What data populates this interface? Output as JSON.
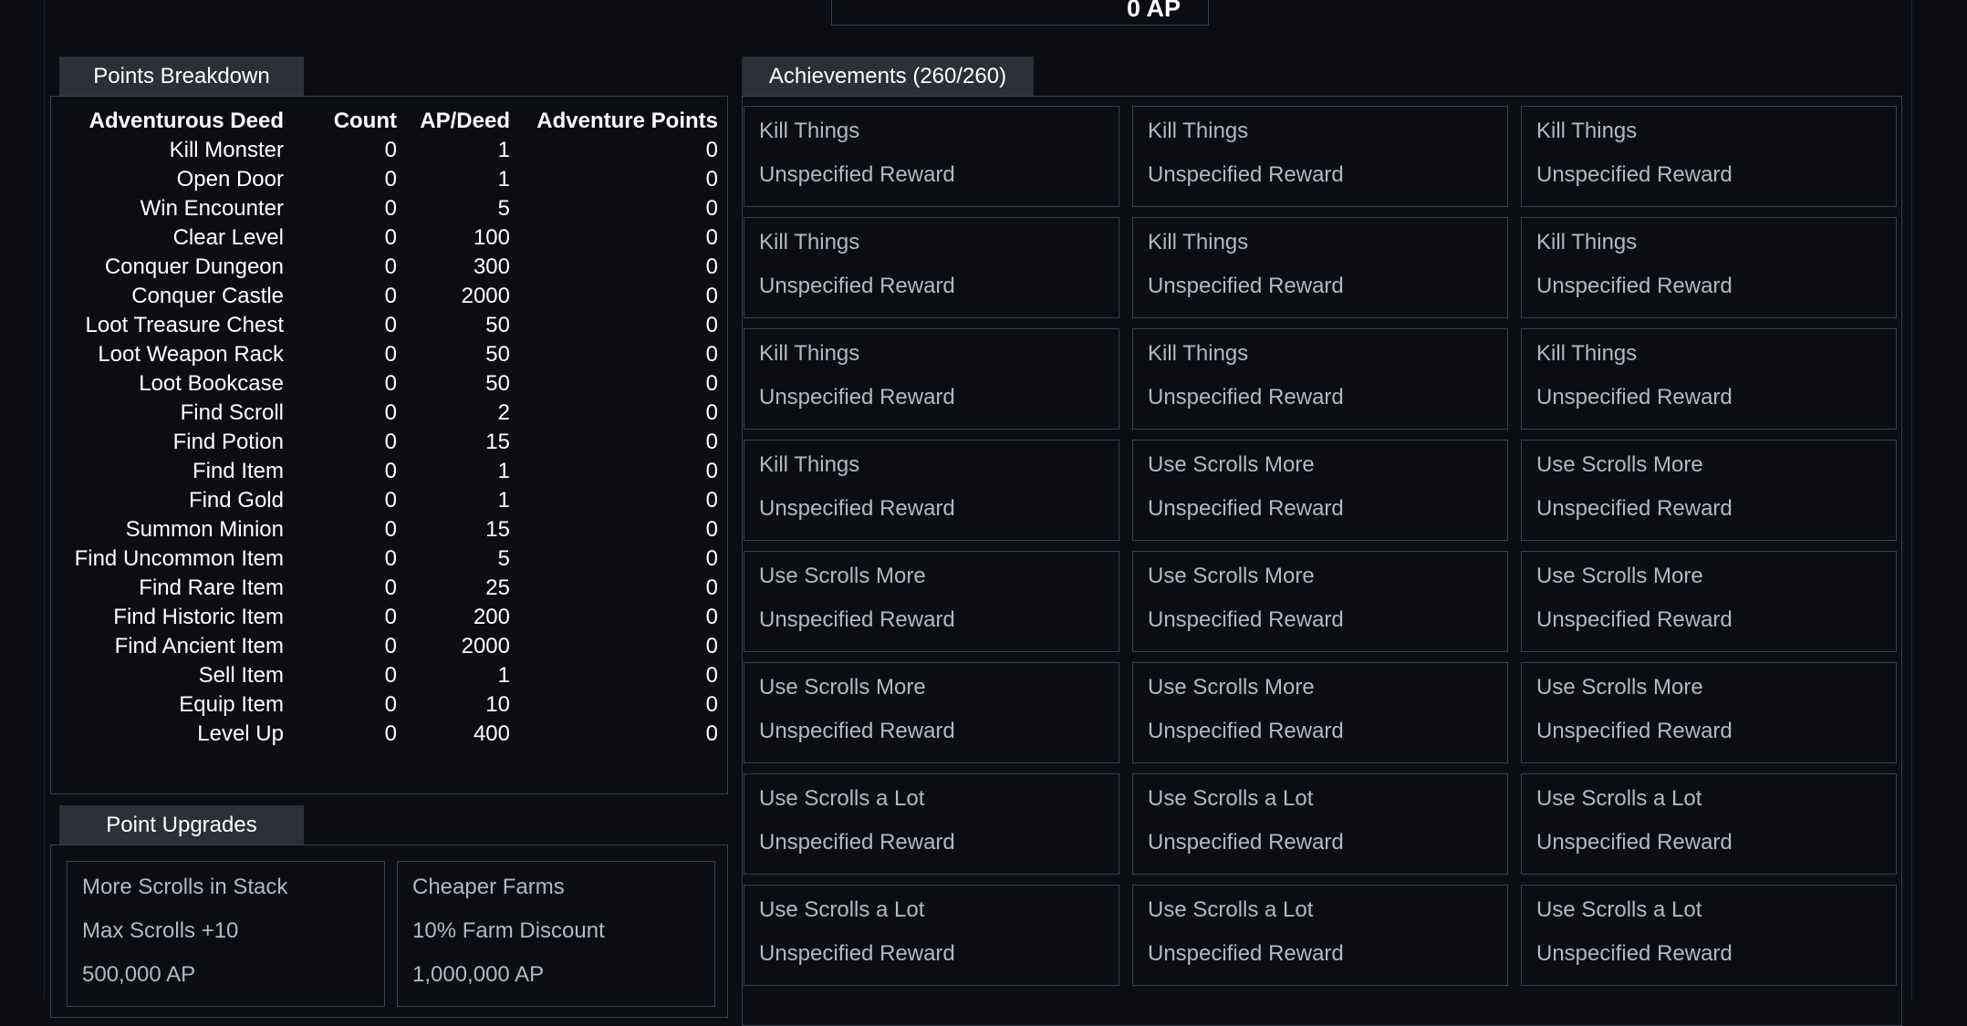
{
  "header": {
    "ap_total": "0 AP"
  },
  "points_breakdown": {
    "tab_label": "Points Breakdown",
    "columns": [
      "Adventurous Deed",
      "Count",
      "AP/Deed",
      "Adventure Points"
    ],
    "rows": [
      [
        "Kill Monster",
        "0",
        "1",
        "0"
      ],
      [
        "Open Door",
        "0",
        "1",
        "0"
      ],
      [
        "Win Encounter",
        "0",
        "5",
        "0"
      ],
      [
        "Clear Level",
        "0",
        "100",
        "0"
      ],
      [
        "Conquer Dungeon",
        "0",
        "300",
        "0"
      ],
      [
        "Conquer Castle",
        "0",
        "2000",
        "0"
      ],
      [
        "Loot Treasure Chest",
        "0",
        "50",
        "0"
      ],
      [
        "Loot Weapon Rack",
        "0",
        "50",
        "0"
      ],
      [
        "Loot Bookcase",
        "0",
        "50",
        "0"
      ],
      [
        "Find Scroll",
        "0",
        "2",
        "0"
      ],
      [
        "Find Potion",
        "0",
        "15",
        "0"
      ],
      [
        "Find Item",
        "0",
        "1",
        "0"
      ],
      [
        "Find Gold",
        "0",
        "1",
        "0"
      ],
      [
        "Summon Minion",
        "0",
        "15",
        "0"
      ],
      [
        "Find Uncommon Item",
        "0",
        "5",
        "0"
      ],
      [
        "Find Rare Item",
        "0",
        "25",
        "0"
      ],
      [
        "Find Historic Item",
        "0",
        "200",
        "0"
      ],
      [
        "Find Ancient Item",
        "0",
        "2000",
        "0"
      ],
      [
        "Sell Item",
        "0",
        "1",
        "0"
      ],
      [
        "Equip Item",
        "0",
        "10",
        "0"
      ],
      [
        "Level Up",
        "0",
        "400",
        "0"
      ]
    ]
  },
  "point_upgrades": {
    "tab_label": "Point Upgrades",
    "items": [
      {
        "name": "More Scrolls in Stack",
        "effect": "Max Scrolls +10",
        "cost": "500,000 AP"
      },
      {
        "name": "Cheaper Farms",
        "effect": "10% Farm Discount",
        "cost": "1,000,000 AP"
      }
    ]
  },
  "achievements": {
    "tab_label": "Achievements (260/260)",
    "items": [
      {
        "name": "Kill Things",
        "reward": "Unspecified Reward"
      },
      {
        "name": "Kill Things",
        "reward": "Unspecified Reward"
      },
      {
        "name": "Kill Things",
        "reward": "Unspecified Reward"
      },
      {
        "name": "Kill Things",
        "reward": "Unspecified Reward"
      },
      {
        "name": "Kill Things",
        "reward": "Unspecified Reward"
      },
      {
        "name": "Kill Things",
        "reward": "Unspecified Reward"
      },
      {
        "name": "Kill Things",
        "reward": "Unspecified Reward"
      },
      {
        "name": "Kill Things",
        "reward": "Unspecified Reward"
      },
      {
        "name": "Kill Things",
        "reward": "Unspecified Reward"
      },
      {
        "name": "Kill Things",
        "reward": "Unspecified Reward"
      },
      {
        "name": "Use Scrolls More",
        "reward": "Unspecified Reward"
      },
      {
        "name": "Use Scrolls More",
        "reward": "Unspecified Reward"
      },
      {
        "name": "Use Scrolls More",
        "reward": "Unspecified Reward"
      },
      {
        "name": "Use Scrolls More",
        "reward": "Unspecified Reward"
      },
      {
        "name": "Use Scrolls More",
        "reward": "Unspecified Reward"
      },
      {
        "name": "Use Scrolls More",
        "reward": "Unspecified Reward"
      },
      {
        "name": "Use Scrolls More",
        "reward": "Unspecified Reward"
      },
      {
        "name": "Use Scrolls More",
        "reward": "Unspecified Reward"
      },
      {
        "name": "Use Scrolls a Lot",
        "reward": "Unspecified Reward"
      },
      {
        "name": "Use Scrolls a Lot",
        "reward": "Unspecified Reward"
      },
      {
        "name": "Use Scrolls a Lot",
        "reward": "Unspecified Reward"
      },
      {
        "name": "Use Scrolls a Lot",
        "reward": "Unspecified Reward"
      },
      {
        "name": "Use Scrolls a Lot",
        "reward": "Unspecified Reward"
      },
      {
        "name": "Use Scrolls a Lot",
        "reward": "Unspecified Reward"
      }
    ]
  }
}
